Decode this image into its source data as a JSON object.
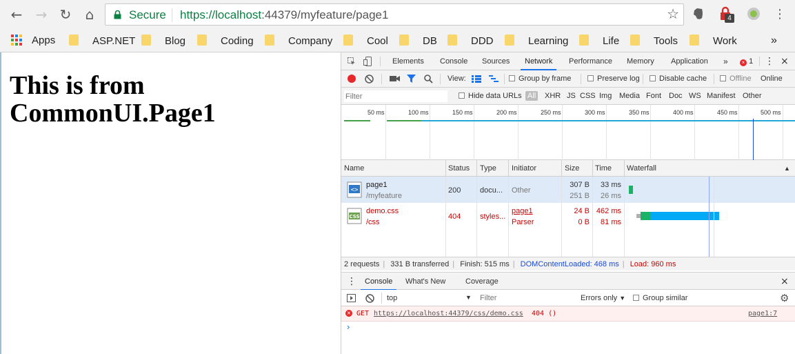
{
  "browser": {
    "secure_label": "Secure",
    "url_scheme_host": "https://localhost",
    "url_rest": ":44379/myfeature/page1",
    "extension_badge": "4",
    "bookmarks": [
      {
        "label": "Apps"
      },
      {
        "label": "ASP.NET"
      },
      {
        "label": "Blog"
      },
      {
        "label": "Coding"
      },
      {
        "label": "Company"
      },
      {
        "label": "Cool"
      },
      {
        "label": "DB"
      },
      {
        "label": "DDD"
      },
      {
        "label": "Learning"
      },
      {
        "label": "Life"
      },
      {
        "label": "Tools"
      },
      {
        "label": "Work"
      }
    ],
    "bookmarks_more": "»"
  },
  "page": {
    "heading": "This is from CommonUI.Page1"
  },
  "devtools": {
    "tabs": [
      "Elements",
      "Console",
      "Sources",
      "Network",
      "Performance",
      "Memory",
      "Application"
    ],
    "active_tab": "Network",
    "error_count": "1",
    "toolbar": {
      "view_label": "View:",
      "group_by_frame": "Group by frame",
      "preserve_log": "Preserve log",
      "disable_cache": "Disable cache",
      "offline": "Offline",
      "online": "Online"
    },
    "filter": {
      "placeholder": "Filter",
      "hide_data_urls": "Hide data URLs",
      "types": [
        "All",
        "XHR",
        "JS",
        "CSS",
        "Img",
        "Media",
        "Font",
        "Doc",
        "WS",
        "Manifest",
        "Other"
      ]
    },
    "timeline_ticks": [
      "50 ms",
      "100 ms",
      "150 ms",
      "200 ms",
      "250 ms",
      "300 ms",
      "350 ms",
      "400 ms",
      "450 ms",
      "500 ms"
    ],
    "columns": [
      "Name",
      "Status",
      "Type",
      "Initiator",
      "Size",
      "Time",
      "Waterfall"
    ],
    "requests": [
      {
        "name": "page1",
        "path": "/myfeature",
        "status": "200",
        "type": "docu...",
        "initiator": "Other",
        "initiator_sub": "",
        "size": "307 B",
        "size_sub": "251 B",
        "time": "33 ms",
        "time_sub": "26 ms",
        "error": false
      },
      {
        "name": "demo.css",
        "path": "/css",
        "status": "404",
        "type": "styles...",
        "initiator": "page1",
        "initiator_sub": "Parser",
        "size": "24 B",
        "size_sub": "0 B",
        "time": "462 ms",
        "time_sub": "81 ms",
        "error": true
      }
    ],
    "status_bar": {
      "requests": "2 requests",
      "transferred": "331 B transferred",
      "finish": "Finish: 515 ms",
      "dom_content_loaded": "DOMContentLoaded: 468 ms",
      "load": "Load: 960 ms"
    },
    "drawer_tabs": [
      "Console",
      "What's New",
      "Coverage"
    ],
    "console": {
      "context": "top",
      "filter_placeholder": "Filter",
      "level": "Errors only",
      "group_similar": "Group similar",
      "error_method": "GET",
      "error_url": "https://localhost:44379/css/demo.css",
      "error_status": "404 ()",
      "error_source": "page1:7",
      "prompt": "›"
    },
    "colors": {
      "dom_content_loaded": "#1a4ad6",
      "load": "#c80000",
      "record": "#e8272a"
    }
  }
}
